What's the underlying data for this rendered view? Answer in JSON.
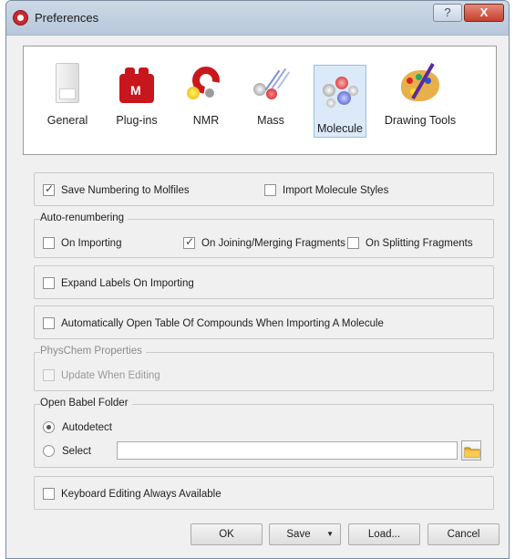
{
  "window": {
    "title": "Preferences",
    "help_label": "?",
    "close_label": "X"
  },
  "categories": [
    {
      "label": "General",
      "icon": "general-icon"
    },
    {
      "label": "Plug-ins",
      "icon": "plugins-icon"
    },
    {
      "label": "NMR",
      "icon": "nmr-magnet-icon"
    },
    {
      "label": "Mass",
      "icon": "mass-icon"
    },
    {
      "label": "Molecule",
      "icon": "molecule-icon",
      "selected": true
    },
    {
      "label": "Drawing Tools",
      "icon": "palette-icon"
    }
  ],
  "save_numbering": {
    "label": "Save Numbering to Molfiles",
    "checked": true
  },
  "import_styles": {
    "label": "Import Molecule Styles",
    "checked": false
  },
  "auto_renumbering": {
    "legend": "Auto-renumbering",
    "on_importing": {
      "label": "On Importing",
      "checked": false
    },
    "on_joining": {
      "label": "On Joining/Merging Fragments",
      "checked": true
    },
    "on_splitting": {
      "label": "On Splitting Fragments",
      "checked": false
    }
  },
  "expand_labels": {
    "label": "Expand Labels On Importing",
    "checked": false
  },
  "open_table": {
    "label": "Automatically Open Table Of Compounds When Importing A Molecule",
    "checked": false
  },
  "physchem": {
    "legend": "PhysChem Properties",
    "update_when_editing": {
      "label": "Update When Editing",
      "checked": false,
      "disabled": true
    }
  },
  "babel": {
    "legend": "Open Babel Folder",
    "autodetect": {
      "label": "Autodetect",
      "selected": true
    },
    "select": {
      "label": "Select",
      "selected": false
    },
    "path_value": ""
  },
  "keyboard_editing": {
    "label": "Keyboard Editing Always Available",
    "checked": false
  },
  "buttons": {
    "ok": "OK",
    "save": "Save",
    "save_arrow": "▼",
    "load": "Load...",
    "cancel": "Cancel"
  }
}
